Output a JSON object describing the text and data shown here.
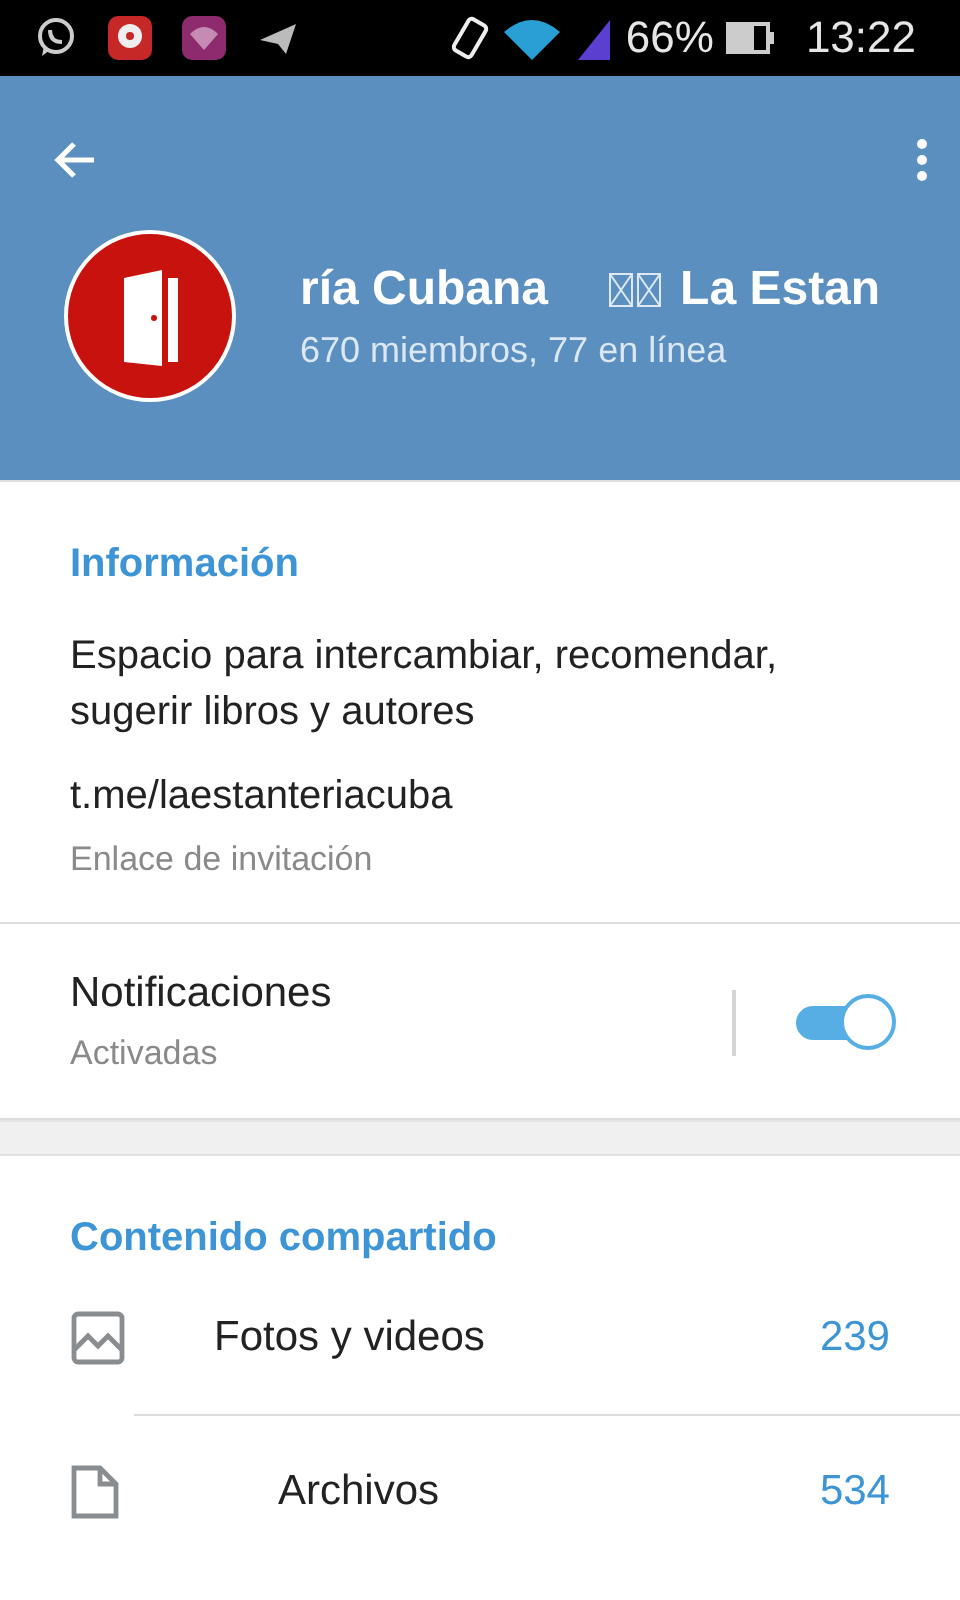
{
  "status_bar": {
    "battery_text": "66%",
    "time": "13:22"
  },
  "header": {
    "title_start": "ría Cubana",
    "title_end": "La Estan",
    "subtitle": "670 miembros, 77 en línea"
  },
  "info": {
    "heading": "Información",
    "description": "Espacio para intercambiar, recomendar, sugerir libros y autores",
    "link": "t.me/laestanteriacuba",
    "link_caption": "Enlace de invitación"
  },
  "notifications": {
    "label": "Notificaciones",
    "state_text": "Activadas",
    "on": true
  },
  "shared": {
    "heading": "Contenido compartido",
    "items": [
      {
        "kind": "photos",
        "label": "Fotos y videos",
        "count": "239"
      },
      {
        "kind": "files",
        "label": "Archivos",
        "count": "534"
      }
    ]
  }
}
